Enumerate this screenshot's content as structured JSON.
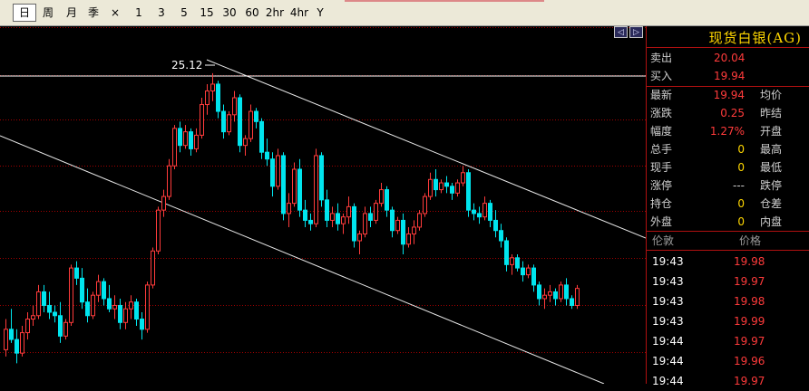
{
  "toolbar": {
    "items": [
      {
        "label": "日",
        "active": true
      },
      {
        "label": "周"
      },
      {
        "label": "月"
      },
      {
        "label": "季"
      },
      {
        "label": "×"
      },
      {
        "label": "1"
      },
      {
        "label": "3"
      },
      {
        "label": "5"
      },
      {
        "label": "15"
      },
      {
        "label": "30"
      },
      {
        "label": "60"
      },
      {
        "label": "2hr"
      },
      {
        "label": "4hr"
      },
      {
        "label": "Y"
      }
    ]
  },
  "chart_data": {
    "type": "candlestick",
    "annotation_high": "25.12",
    "candles": [
      [
        17.0,
        17.9,
        16.8,
        17.6
      ],
      [
        17.6,
        18.2,
        17.2,
        17.3
      ],
      [
        17.3,
        17.6,
        16.6,
        16.9
      ],
      [
        16.9,
        17.7,
        16.8,
        17.5
      ],
      [
        17.5,
        18.1,
        17.3,
        17.9
      ],
      [
        17.9,
        18.3,
        17.7,
        18.0
      ],
      [
        18.0,
        18.9,
        17.9,
        18.7
      ],
      [
        18.7,
        18.9,
        18.1,
        18.3
      ],
      [
        18.3,
        18.7,
        17.9,
        18.1
      ],
      [
        18.1,
        18.3,
        17.8,
        18.0
      ],
      [
        18.0,
        18.4,
        17.2,
        17.4
      ],
      [
        17.4,
        17.9,
        17.3,
        17.8
      ],
      [
        17.8,
        19.5,
        17.7,
        19.4
      ],
      [
        19.4,
        19.6,
        18.9,
        19.1
      ],
      [
        19.1,
        19.4,
        18.2,
        18.4
      ],
      [
        18.4,
        18.8,
        17.8,
        18.0
      ],
      [
        18.0,
        18.7,
        17.9,
        18.6
      ],
      [
        18.6,
        19.2,
        18.4,
        19.0
      ],
      [
        19.0,
        19.1,
        18.3,
        18.5
      ],
      [
        18.5,
        18.9,
        18.1,
        18.2
      ],
      [
        18.2,
        18.6,
        17.9,
        18.3
      ],
      [
        18.3,
        18.5,
        17.6,
        17.8
      ],
      [
        17.8,
        18.4,
        17.6,
        18.2
      ],
      [
        18.2,
        18.6,
        17.9,
        18.4
      ],
      [
        18.4,
        18.5,
        17.7,
        17.9
      ],
      [
        17.9,
        18.1,
        17.3,
        17.6
      ],
      [
        17.6,
        19.0,
        17.5,
        18.9
      ],
      [
        18.9,
        20.0,
        18.8,
        19.9
      ],
      [
        19.9,
        21.2,
        19.8,
        21.1
      ],
      [
        21.1,
        21.7,
        20.9,
        21.5
      ],
      [
        21.5,
        22.6,
        21.4,
        22.4
      ],
      [
        22.4,
        23.6,
        22.3,
        23.5
      ],
      [
        23.5,
        23.7,
        22.8,
        23.0
      ],
      [
        23.0,
        23.6,
        22.9,
        23.4
      ],
      [
        23.4,
        23.5,
        22.7,
        22.9
      ],
      [
        22.9,
        23.5,
        22.8,
        23.3
      ],
      [
        23.3,
        24.4,
        23.2,
        24.2
      ],
      [
        24.2,
        24.8,
        23.9,
        24.6
      ],
      [
        24.6,
        25.12,
        24.3,
        24.8
      ],
      [
        24.8,
        24.9,
        23.8,
        24.0
      ],
      [
        24.0,
        24.2,
        23.2,
        23.4
      ],
      [
        23.4,
        24.0,
        23.3,
        23.9
      ],
      [
        23.9,
        24.6,
        23.7,
        24.4
      ],
      [
        24.4,
        24.5,
        22.8,
        23.0
      ],
      [
        23.0,
        23.3,
        22.7,
        23.2
      ],
      [
        23.2,
        24.2,
        23.1,
        24.0
      ],
      [
        24.0,
        24.1,
        23.5,
        23.7
      ],
      [
        23.7,
        23.8,
        22.6,
        22.8
      ],
      [
        22.8,
        23.2,
        22.4,
        22.6
      ],
      [
        22.6,
        22.8,
        21.5,
        21.8
      ],
      [
        21.8,
        22.9,
        21.7,
        22.7
      ],
      [
        22.7,
        22.8,
        20.8,
        21.0
      ],
      [
        21.0,
        21.6,
        20.6,
        21.3
      ],
      [
        21.3,
        22.5,
        21.2,
        22.3
      ],
      [
        22.3,
        22.6,
        20.9,
        21.1
      ],
      [
        21.1,
        21.4,
        20.6,
        20.8
      ],
      [
        20.8,
        21.0,
        20.5,
        20.7
      ],
      [
        20.7,
        22.9,
        20.6,
        22.7
      ],
      [
        22.7,
        22.8,
        21.2,
        21.4
      ],
      [
        21.4,
        21.7,
        20.6,
        20.8
      ],
      [
        20.8,
        21.2,
        20.6,
        21.0
      ],
      [
        21.0,
        21.3,
        20.5,
        20.7
      ],
      [
        20.7,
        21.0,
        20.4,
        20.9
      ],
      [
        20.9,
        21.5,
        20.7,
        21.2
      ],
      [
        21.2,
        21.3,
        20.0,
        20.2
      ],
      [
        20.2,
        20.5,
        19.8,
        20.4
      ],
      [
        20.4,
        21.2,
        20.3,
        21.0
      ],
      [
        21.0,
        21.2,
        20.6,
        20.8
      ],
      [
        20.8,
        21.4,
        20.7,
        21.3
      ],
      [
        21.3,
        21.9,
        21.2,
        21.7
      ],
      [
        21.7,
        21.8,
        20.9,
        21.1
      ],
      [
        21.1,
        21.2,
        20.3,
        20.5
      ],
      [
        20.5,
        20.9,
        20.4,
        20.8
      ],
      [
        20.8,
        21.0,
        19.8,
        20.1
      ],
      [
        20.1,
        20.6,
        20.0,
        20.4
      ],
      [
        20.4,
        20.8,
        20.1,
        20.6
      ],
      [
        20.6,
        21.1,
        20.5,
        21.0
      ],
      [
        21.0,
        21.6,
        20.9,
        21.5
      ],
      [
        21.5,
        22.2,
        21.4,
        22.0
      ],
      [
        22.0,
        22.3,
        21.5,
        21.7
      ],
      [
        21.7,
        22.0,
        21.6,
        21.9
      ],
      [
        21.9,
        22.1,
        21.6,
        21.8
      ],
      [
        21.8,
        21.9,
        21.4,
        21.6
      ],
      [
        21.6,
        22.0,
        21.5,
        21.9
      ],
      [
        21.9,
        22.4,
        21.8,
        22.2
      ],
      [
        22.2,
        22.3,
        20.9,
        21.1
      ],
      [
        21.1,
        21.3,
        20.8,
        21.0
      ],
      [
        21.0,
        21.2,
        20.7,
        20.9
      ],
      [
        20.9,
        21.5,
        20.8,
        21.3
      ],
      [
        21.3,
        21.4,
        20.6,
        20.8
      ],
      [
        20.8,
        21.1,
        20.3,
        20.5
      ],
      [
        20.5,
        20.7,
        20.0,
        20.2
      ],
      [
        20.2,
        20.3,
        19.3,
        19.5
      ],
      [
        19.5,
        19.8,
        19.2,
        19.7
      ],
      [
        19.7,
        19.8,
        19.3,
        19.4
      ],
      [
        19.4,
        19.6,
        19.0,
        19.2
      ],
      [
        19.2,
        19.5,
        19.1,
        19.4
      ],
      [
        19.4,
        19.5,
        18.7,
        18.9
      ],
      [
        18.9,
        19.0,
        18.3,
        18.5
      ],
      [
        18.5,
        18.8,
        18.2,
        18.6
      ],
      [
        18.6,
        18.9,
        18.4,
        18.7
      ],
      [
        18.7,
        18.8,
        18.3,
        18.5
      ],
      [
        18.5,
        19.0,
        18.4,
        18.9
      ],
      [
        18.9,
        19.1,
        18.3,
        18.5
      ],
      [
        18.5,
        18.6,
        18.2,
        18.3
      ],
      [
        18.3,
        18.9,
        18.2,
        18.8
      ]
    ],
    "price_range": [
      16.0,
      26.5
    ]
  },
  "quote": {
    "instrument": "现货白银(AG)",
    "sell_label": "卖出",
    "sell_value": "20.04",
    "buy_label": "买入",
    "buy_value": "19.94",
    "last_label": "最新",
    "last_value": "19.94",
    "avg_label": "均价",
    "change_label": "涨跌",
    "change_value": "0.25",
    "prev_label": "昨结",
    "pct_label": "幅度",
    "pct_value": "1.27%",
    "open_label": "开盘",
    "vol_label": "总手",
    "vol_value": "0",
    "high_label": "最高",
    "cur_label": "现手",
    "cur_value": "0",
    "low_label": "最低",
    "limitup_label": "涨停",
    "limitup_value": "---",
    "limitdown_label": "跌停",
    "oi_label": "持仓",
    "oi_value": "0",
    "oidiff_label": "仓差",
    "outer_label": "外盘",
    "outer_value": "0",
    "inner_label": "内盘"
  },
  "ticks": {
    "header_time": "伦敦",
    "header_price": "价格",
    "rows": [
      {
        "time": "19:43",
        "price": "19.98"
      },
      {
        "time": "19:43",
        "price": "19.97"
      },
      {
        "time": "19:43",
        "price": "19.98"
      },
      {
        "time": "19:43",
        "price": "19.99"
      },
      {
        "time": "19:44",
        "price": "19.97"
      },
      {
        "time": "19:44",
        "price": "19.96"
      },
      {
        "time": "19:44",
        "price": "19.97"
      }
    ]
  },
  "colors": {
    "up": "#ff3b3b",
    "down": "#00e5ee",
    "grid": "#a00000",
    "trend": "#e8e8e8",
    "quote_label": "#d0d0d0",
    "quote_value": "#ff3b3b",
    "quote_zero": "#ffd700"
  },
  "icons": {
    "nav_left": "nav-left-icon",
    "nav_right": "nav-right-icon"
  }
}
